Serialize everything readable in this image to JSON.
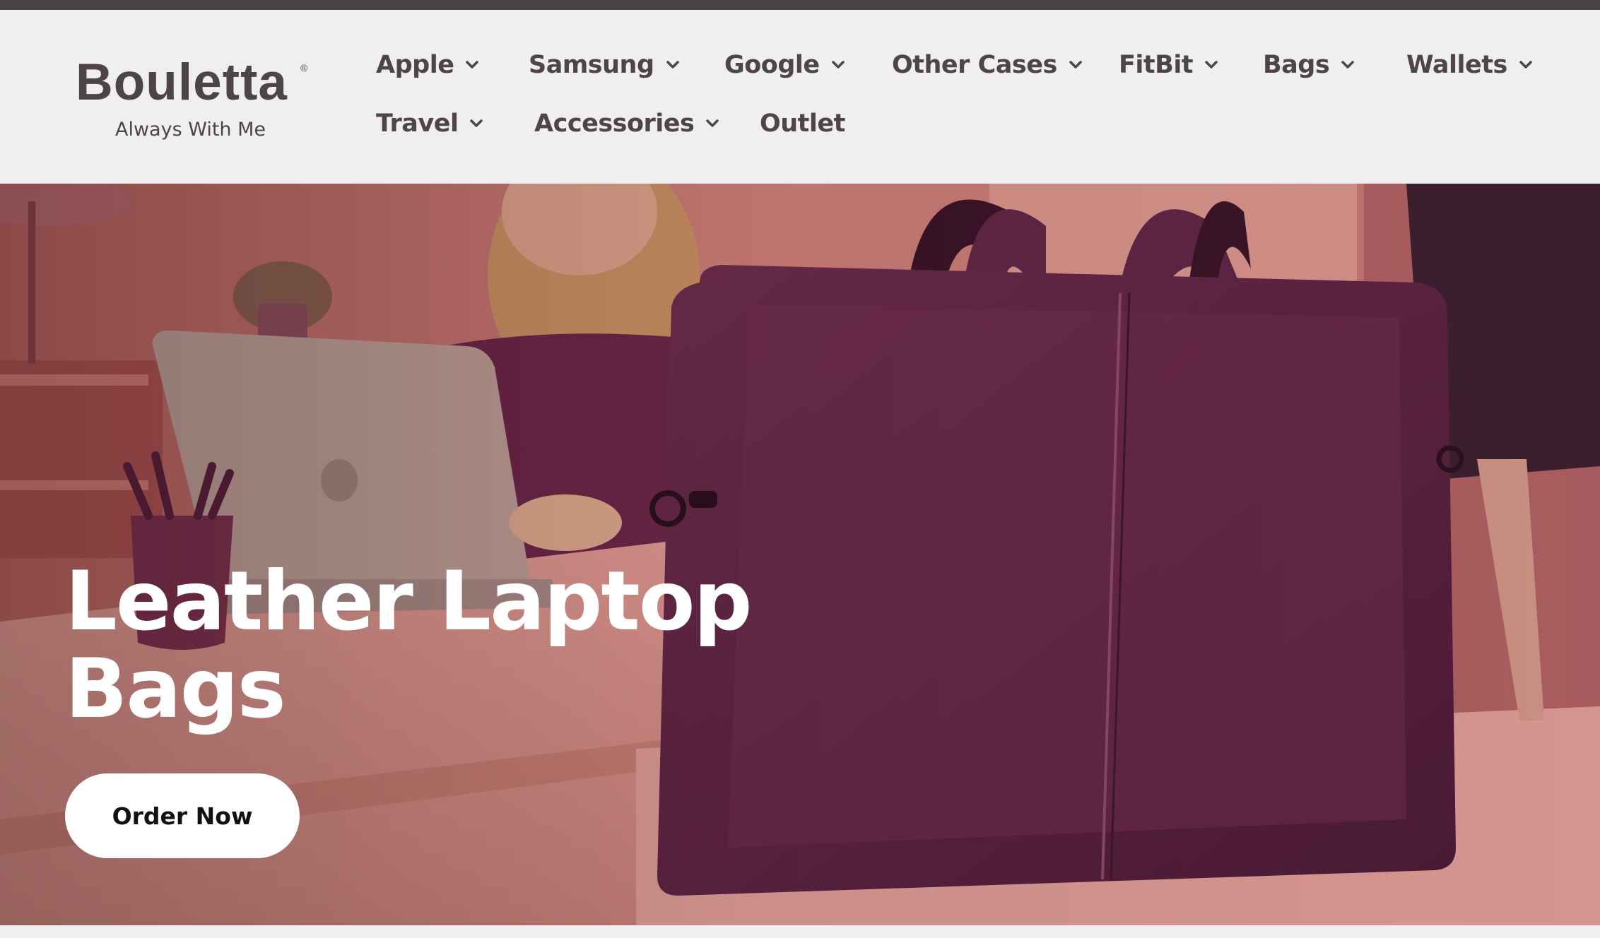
{
  "brand": {
    "name": "Bouletta",
    "registered": "®",
    "tagline": "Always With Me"
  },
  "nav": {
    "row1": [
      {
        "label": "Apple",
        "dropdown": true
      },
      {
        "label": "Samsung",
        "dropdown": true
      },
      {
        "label": "Google",
        "dropdown": true
      },
      {
        "label": "Other Cases",
        "dropdown": true
      },
      {
        "label": "FitBit",
        "dropdown": true
      },
      {
        "label": "Bags",
        "dropdown": true
      },
      {
        "label": "Wallets",
        "dropdown": true
      }
    ],
    "row2": [
      {
        "label": "Travel",
        "dropdown": true
      },
      {
        "label": "Accessories",
        "dropdown": true
      },
      {
        "label": "Outlet",
        "dropdown": false
      }
    ]
  },
  "hero": {
    "title_line1": "Leather Laptop",
    "title_line2": "Bags",
    "cta_label": "Order Now"
  },
  "colors": {
    "top_bar": "#4a4145",
    "header_bg": "#efefef",
    "nav_text": "#4f4448",
    "hero_bag": "#5a2340",
    "hero_bg": "#b9706e",
    "cta_bg": "#ffffff"
  },
  "icons": {
    "dropdown": "chevron-down-icon"
  }
}
